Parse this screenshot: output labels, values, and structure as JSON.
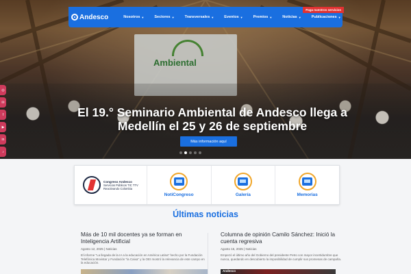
{
  "nav": {
    "logo": "Andesco",
    "items": [
      {
        "label": "Nosotros"
      },
      {
        "label": "Sectores"
      },
      {
        "label": "Transversales"
      },
      {
        "label": "Eventos"
      },
      {
        "label": "Premios"
      },
      {
        "label": "Noticias"
      },
      {
        "label": "Publicaciones"
      }
    ],
    "pay_badge": "Paga nuestros servicios"
  },
  "hero": {
    "title": "El 19.° Seminario Ambiental de Andesco llega a Medellín el 25 y 26 de septiembre",
    "banner_word": "Ambiental",
    "button": "Más información aquí",
    "slides": 5,
    "active_slide": 1
  },
  "social_icons": [
    "instagram-icon",
    "mail-icon",
    "facebook-icon",
    "youtube-icon",
    "linkedin-icon",
    "tiktok-icon"
  ],
  "quicklinks": {
    "congress": {
      "line1": "Congreso Andesco",
      "line2": "Servicios Públicos TIC TTV",
      "line3": "Reactivando Colombia"
    },
    "items": [
      {
        "label": "NotiCongreso",
        "icon": "noticongreso-icon"
      },
      {
        "label": "Galería",
        "icon": "gallery-icon"
      },
      {
        "label": "Memorias",
        "icon": "memories-icon"
      }
    ]
  },
  "news": {
    "heading": "Últimas noticias",
    "cards": [
      {
        "title": "Más de 10 mil docentes ya se forman en Inteligencia Artificial",
        "meta": "Agosto 12, 2025 | Noticias",
        "excerpt": "El informe \"La llegada de la IA a la educación en América Latina\" hecho por la Fundación Telefónica Movistar y Fundación \"la Caixa\" y la OEI mostró la relevancia de este campo en la educación."
      },
      {
        "title": "Columna de opinión Camilo Sánchez: Inició la cuenta regresiva",
        "meta": "Agosto 15, 2025 | Noticias",
        "excerpt": "Empezó el último año del Gobierno del presidente Petro con mayor incertidumbre que nunca, quedando en descubierto la imposibilidad de cumplir sus promesas de campaña.",
        "strip_brand": "Andesco"
      }
    ]
  }
}
